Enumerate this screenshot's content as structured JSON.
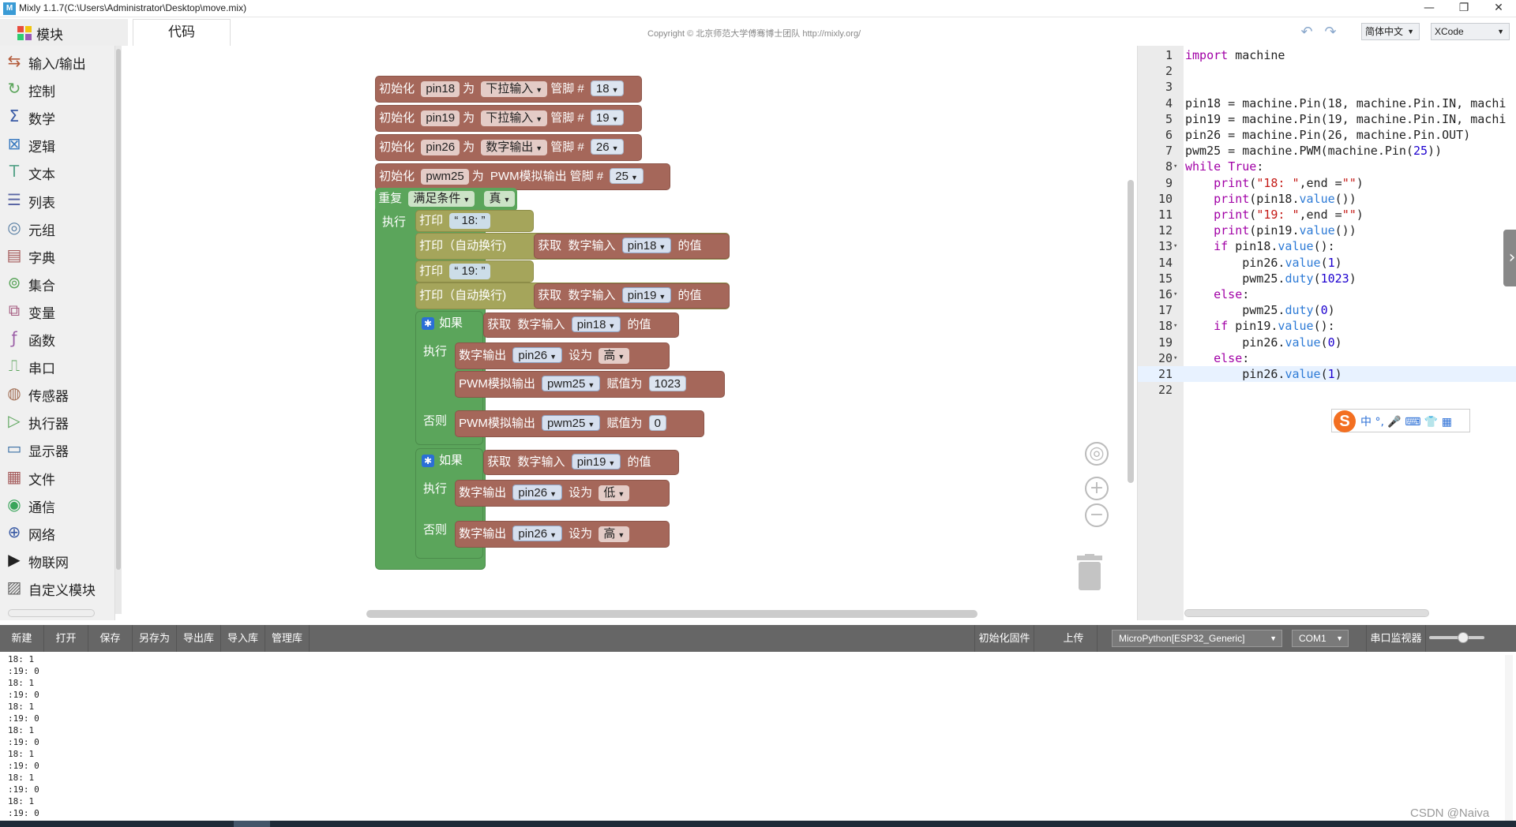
{
  "window": {
    "title": "Mixly 1.1.7(C:\\Users\\Administrator\\Desktop\\move.mix)",
    "icon": "mixly-app-icon"
  },
  "header": {
    "modules_tab": "模块",
    "code_tab": "代码",
    "copyright": "Copyright © 北京师范大学傅骞博士团队 http://mixly.org/",
    "language_select": "简体中文",
    "theme_select": "XCode"
  },
  "sidebar": {
    "items": [
      {
        "label": "输入/输出",
        "icon": "io-icon",
        "color": "#b35a3a"
      },
      {
        "label": "控制",
        "icon": "control-icon",
        "color": "#5ba55b"
      },
      {
        "label": "数学",
        "icon": "math-icon",
        "color": "#3a5ba5"
      },
      {
        "label": "逻辑",
        "icon": "logic-icon",
        "color": "#3a7ac0"
      },
      {
        "label": "文本",
        "icon": "text-icon",
        "color": "#5ba58c"
      },
      {
        "label": "列表",
        "icon": "list-icon",
        "color": "#5b67a5"
      },
      {
        "label": "元组",
        "icon": "tuple-icon",
        "color": "#5b80a5"
      },
      {
        "label": "字典",
        "icon": "dict-icon",
        "color": "#a55b5b"
      },
      {
        "label": "集合",
        "icon": "set-icon",
        "color": "#5ba55b"
      },
      {
        "label": "变量",
        "icon": "variable-icon",
        "color": "#a55b80"
      },
      {
        "label": "函数",
        "icon": "function-icon",
        "color": "#995ba5"
      },
      {
        "label": "串口",
        "icon": "serial-icon",
        "color": "#5ba55b"
      },
      {
        "label": "传感器",
        "icon": "sensor-icon",
        "color": "#a5745b"
      },
      {
        "label": "执行器",
        "icon": "actuator-icon",
        "color": "#5ba55b"
      },
      {
        "label": "显示器",
        "icon": "display-icon",
        "color": "#3a6fa5"
      },
      {
        "label": "文件",
        "icon": "file-icon",
        "color": "#a55b5b"
      },
      {
        "label": "通信",
        "icon": "communication-icon",
        "color": "#3aa55b"
      },
      {
        "label": "网络",
        "icon": "network-icon",
        "color": "#3a5ba5"
      },
      {
        "label": "物联网",
        "icon": "triangle-icon",
        "color": "#222222"
      },
      {
        "label": "自定义模块",
        "icon": "custom-module-icon",
        "color": "#666666"
      }
    ]
  },
  "blocks": {
    "init1": {
      "prefix": "初始化",
      "var": "pin18",
      "as": "为",
      "mode": "下拉输入",
      "pin_label": "管脚 #",
      "pin": "18"
    },
    "init2": {
      "prefix": "初始化",
      "var": "pin19",
      "as": "为",
      "mode": "下拉输入",
      "pin_label": "管脚 #",
      "pin": "19"
    },
    "init3": {
      "prefix": "初始化",
      "var": "pin26",
      "as": "为",
      "mode": "数字输出",
      "pin_label": "管脚 #",
      "pin": "26"
    },
    "init4": {
      "prefix": "初始化",
      "var": "pwm25",
      "as": "为",
      "mode": "PWM模拟输出",
      "pin_label": "管脚 #",
      "pin": "25"
    },
    "loop": {
      "label": "重复",
      "cond_type": "满足条件",
      "cond": "真",
      "do": "执行"
    },
    "print1": {
      "label": "打印",
      "text": "18:"
    },
    "println1": {
      "label": "打印（自动换行)",
      "get": "获取",
      "kind": "数字输入",
      "var": "pin18",
      "suffix": "的值"
    },
    "print2": {
      "label": "打印",
      "text": "19:"
    },
    "println2": {
      "label": "打印（自动换行)",
      "get": "获取",
      "kind": "数字输入",
      "var": "pin19",
      "suffix": "的值"
    },
    "if1": {
      "label": "如果",
      "get": "获取",
      "kind": "数字输入",
      "var": "pin18",
      "suffix": "的值",
      "do": "执行",
      "else": "否则"
    },
    "if1_do1": {
      "kind": "数字输出",
      "var": "pin26",
      "set": "设为",
      "val": "高"
    },
    "if1_do2": {
      "kind": "PWM模拟输出",
      "var": "pwm25",
      "set": "赋值为",
      "val": "1023"
    },
    "if1_else": {
      "kind": "PWM模拟输出",
      "var": "pwm25",
      "set": "赋值为",
      "val": "0"
    },
    "if2": {
      "label": "如果",
      "get": "获取",
      "kind": "数字输入",
      "var": "pin19",
      "suffix": "的值",
      "do": "执行",
      "else": "否则"
    },
    "if2_do1": {
      "kind": "数字输出",
      "var": "pin26",
      "set": "设为",
      "val": "低"
    },
    "if2_else": {
      "kind": "数字输出",
      "var": "pin26",
      "set": "设为",
      "val": "高"
    }
  },
  "code": {
    "lines": [
      {
        "n": "1",
        "t": "import machine"
      },
      {
        "n": "2",
        "t": ""
      },
      {
        "n": "3",
        "t": ""
      },
      {
        "n": "4",
        "t": "pin18 = machine.Pin(18, machine.Pin.IN, machi"
      },
      {
        "n": "5",
        "t": "pin19 = machine.Pin(19, machine.Pin.IN, machi"
      },
      {
        "n": "6",
        "t": "pin26 = machine.Pin(26, machine.Pin.OUT)"
      },
      {
        "n": "7",
        "t": "pwm25 = machine.PWM(machine.Pin(25))"
      },
      {
        "n": "8",
        "t": "while True:"
      },
      {
        "n": "9",
        "t": "    print(\"18: \",end =\"\")"
      },
      {
        "n": "10",
        "t": "    print(pin18.value())"
      },
      {
        "n": "11",
        "t": "    print(\"19: \",end =\"\")"
      },
      {
        "n": "12",
        "t": "    print(pin19.value())"
      },
      {
        "n": "13",
        "t": "    if pin18.value():"
      },
      {
        "n": "14",
        "t": "        pin26.value(1)"
      },
      {
        "n": "15",
        "t": "        pwm25.duty(1023)"
      },
      {
        "n": "16",
        "t": "    else:"
      },
      {
        "n": "17",
        "t": "        pwm25.duty(0)"
      },
      {
        "n": "18",
        "t": "    if pin19.value():"
      },
      {
        "n": "19",
        "t": "        pin26.value(0)"
      },
      {
        "n": "20",
        "t": "    else:"
      },
      {
        "n": "21",
        "t": "        pin26.value(1)"
      },
      {
        "n": "22",
        "t": ""
      }
    ],
    "ime_text": "中 °, 🎤 ⌨ 👕 ▦"
  },
  "toolbar": {
    "new": "新建",
    "open": "打开",
    "save": "保存",
    "save_as": "另存为",
    "export_lib": "导出库",
    "import_lib": "导入库",
    "manage_lib": "管理库",
    "init_firmware": "初始化固件",
    "upload": "上传",
    "board": "MicroPython[ESP32_Generic]",
    "port": "COM1",
    "serial_monitor": "串口监视器"
  },
  "console": {
    "lines": [
      "18: 1",
      ":19: 0",
      "18: 1",
      ":19: 0",
      "18: 1",
      ":19: 0",
      "18: 1",
      ":19: 0",
      "18: 1",
      ":19: 0",
      "18: 1",
      ":19: 0",
      "18: 1",
      ":19: 0"
    ]
  },
  "watermark": "CSDN @Naiva"
}
